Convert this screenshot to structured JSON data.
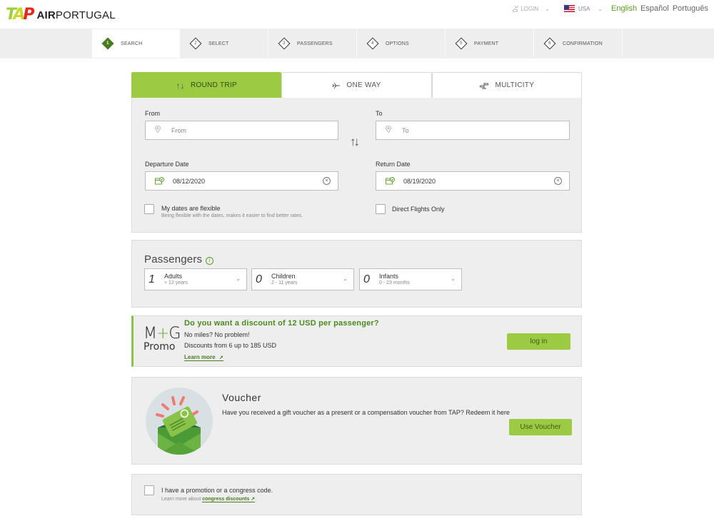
{
  "header": {
    "logo_mark": [
      "T",
      "A",
      "P"
    ],
    "logo_text_bold": "AIR",
    "logo_text": "PORTUGAL",
    "login_label": "LOGIN",
    "country_label": "USA",
    "languages": [
      {
        "label": "English",
        "active": true
      },
      {
        "label": "Español",
        "active": false
      },
      {
        "label": "Português",
        "active": false
      }
    ]
  },
  "steps": [
    {
      "number": "1",
      "label": "SEARCH",
      "active": true
    },
    {
      "number": "2",
      "label": "SELECT",
      "active": false
    },
    {
      "number": "3",
      "label": "PASSENGERS",
      "active": false
    },
    {
      "number": "4",
      "label": "OPTIONS",
      "active": false
    },
    {
      "number": "5",
      "label": "PAYMENT",
      "active": false
    },
    {
      "number": "6",
      "label": "CONFIRMATION",
      "active": false
    }
  ],
  "trip_tabs": [
    {
      "label": "ROUND TRIP",
      "icon": "round-trip-arrows-icon",
      "glyph": "⇅",
      "active": true
    },
    {
      "label": "ONE WAY",
      "icon": "plane-icon",
      "glyph": "✈",
      "active": false
    },
    {
      "label": "MULTICITY",
      "icon": "signpost-icon",
      "glyph": "⇄",
      "active": false
    }
  ],
  "search": {
    "from_label": "From",
    "from_placeholder": "From",
    "to_label": "To",
    "to_placeholder": "To",
    "swap_glyph": "↑↓",
    "departure_label": "Departure Date",
    "departure_value": "08/12/2020",
    "return_label": "Return Date",
    "return_value": "08/19/2020",
    "flexible_label": "My dates are flexible",
    "flexible_sub": "Being flexible with the dates, makes it easier to find better rates.",
    "flexible_checked": false,
    "direct_label": "Direct Flights Only",
    "direct_checked": false
  },
  "passengers": {
    "title": "Passengers",
    "info_glyph": "i",
    "items": [
      {
        "count": "1",
        "label": "Adults",
        "sub": "+ 12 years"
      },
      {
        "count": "0",
        "label": "Children",
        "sub": "2 - 11 years"
      },
      {
        "count": "0",
        "label": "Infants",
        "sub": "0 - 23 months"
      }
    ]
  },
  "promo": {
    "logo_m": "M",
    "logo_plus": "+",
    "logo_g": "G",
    "logo_sub": "Promo",
    "title": "Do you want a discount of 12 USD per passenger?",
    "line1": "No miles? No problem!",
    "line2": "Discounts from 6 up to 185 USD",
    "learn_more": "Learn more",
    "button": "log in"
  },
  "voucher": {
    "title": "Voucher",
    "text": "Have you received a gift voucher as a present or a compensation voucher from TAP? Redeem it here",
    "button": "Use Voucher"
  },
  "promo_code": {
    "label": "I have a promotion or a congress code.",
    "sub_prefix": "Learn more about ",
    "sub_link": "congress discounts",
    "sub_suffix": ".",
    "checked": false
  },
  "colors": {
    "brand_green": "#9ccb43",
    "dark_green": "#4a7a20",
    "brand_red": "#e1261c"
  }
}
